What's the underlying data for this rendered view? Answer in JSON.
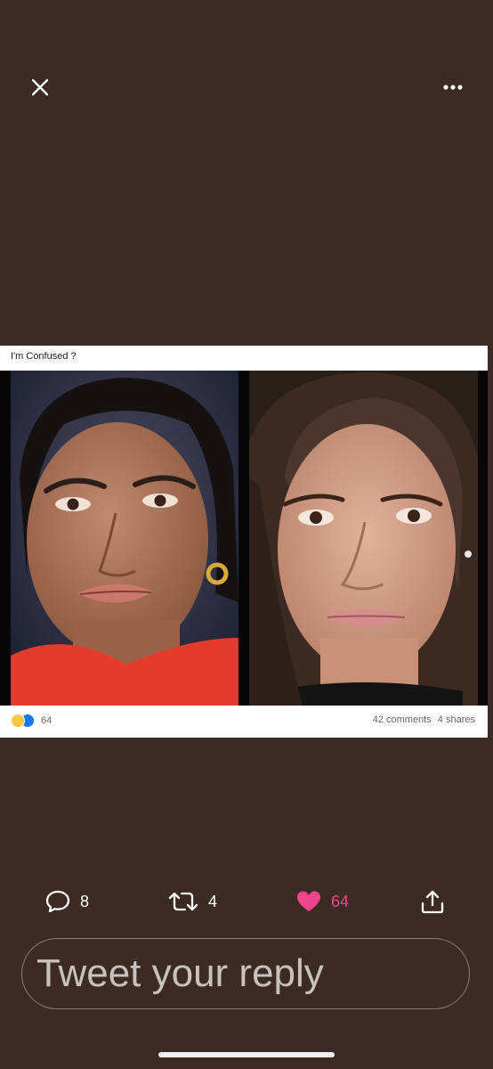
{
  "viewer": {
    "close_icon": "close-icon",
    "more_icon": "more-horizontal-icon"
  },
  "post": {
    "caption": "I'm Confused ?",
    "reactions": {
      "icons": [
        "haha-reaction-icon",
        "like-reaction-icon"
      ],
      "count": "64"
    },
    "comments": "42 comments",
    "shares": "4 shares"
  },
  "actions": {
    "reply_count": "8",
    "retweet_count": "4",
    "like_count": "64",
    "like_color": "#f0458c"
  },
  "reply": {
    "placeholder": "Tweet your reply"
  }
}
